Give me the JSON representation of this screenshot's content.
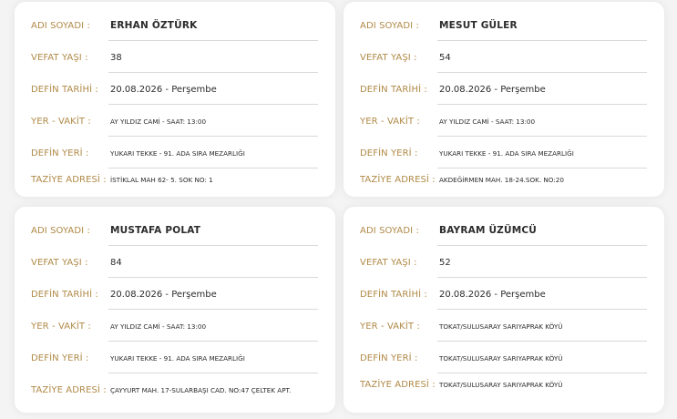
{
  "labels": {
    "name": "ADI SOYADI :",
    "age": "VEFAT YAŞI :",
    "burial_date": "DEFİN TARİHİ :",
    "place_time": "YER - VAKİT :",
    "burial_place": "DEFİN YERİ :",
    "condolence_address": "TAZİYE ADRESİ :"
  },
  "cards": [
    {
      "name": "ERHAN ÖZTÜRK",
      "age": "38",
      "burial_date": "20.08.2026 - Perşembe",
      "place_time": "AY YILDIZ CAMİ - SAAT: 13:00",
      "burial_place": "YUKARI TEKKE - 91. ADA SIRA MEZARLIĞI",
      "condolence_address": "İSTİKLAL MAH 62- 5. SOK NO: 1"
    },
    {
      "name": "MESUT GÜLER",
      "age": "54",
      "burial_date": "20.08.2026 - Perşembe",
      "place_time": "AY YILDIZ CAMİ - SAAT: 13:00",
      "burial_place": "YUKARI TEKKE - 91. ADA SIRA MEZARLIĞI",
      "condolence_address": "AKDEĞİRMEN MAH. 18-24.SOK. NO:20"
    },
    {
      "name": "MUSTAFA POLAT",
      "age": "84",
      "burial_date": "20.08.2026 - Perşembe",
      "place_time": "AY YILDIZ CAMİ - SAAT: 13:00",
      "burial_place": "YUKARI TEKKE - 91. ADA SIRA MEZARLIĞI",
      "condolence_address": "ÇAYYURT MAH. 17-SULARBAŞI CAD. NO:47 ÇELTEK APT."
    },
    {
      "name": "BAYRAM ÜZÜMCÜ",
      "age": "52",
      "burial_date": "20.08.2026 - Perşembe",
      "place_time": "TOKAT/SULUSARAY SARIYAPRAK KÖYÜ",
      "burial_place": "TOKAT/SULUSARAY SARIYAPRAK KÖYÜ",
      "condolence_address": "TOKAT/SULUSARAY SARIYAPRAK KÖYÜ"
    }
  ],
  "colors": {
    "label": "#b08a47",
    "value": "#2b2b2b",
    "divider": "#d9d9d9",
    "card_bg": "#ffffff",
    "page_bg": "#f4f4f4"
  }
}
